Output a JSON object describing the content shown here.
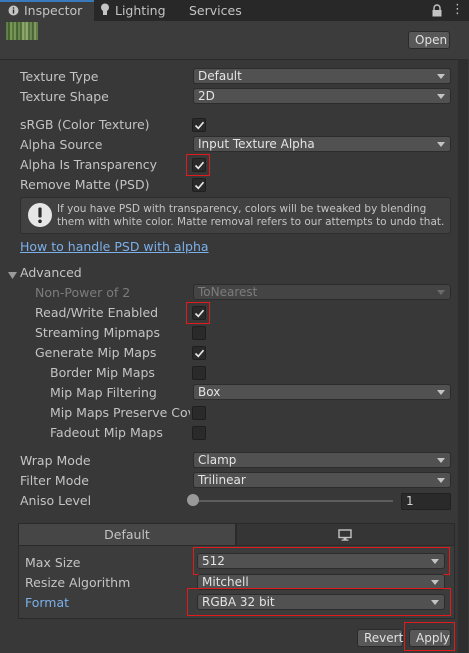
{
  "tabs": [
    {
      "label": "Inspector",
      "active": true,
      "icon": "inspector-info-icon"
    },
    {
      "label": "Lighting",
      "active": false,
      "icon": "lightbulb-icon"
    },
    {
      "label": "Services",
      "active": false
    }
  ],
  "header": {
    "open_label": "Open"
  },
  "fields": {
    "texture_type": {
      "label": "Texture Type",
      "value": "Default"
    },
    "texture_shape": {
      "label": "Texture Shape",
      "value": "2D"
    },
    "srgb": {
      "label": "sRGB (Color Texture)",
      "checked": true
    },
    "alpha_source": {
      "label": "Alpha Source",
      "value": "Input Texture Alpha"
    },
    "alpha_transparency": {
      "label": "Alpha Is Transparency",
      "checked": true
    },
    "remove_matte": {
      "label": "Remove Matte (PSD)",
      "checked": true
    },
    "help_text": "If you have PSD with transparency, colors will be tweaked by blending them with white color. Matte removal refers to our attempts to undo that.",
    "help_link": "How to handle PSD with alpha"
  },
  "advanced": {
    "label": "Advanced",
    "non_power_of_2": {
      "label": "Non-Power of 2",
      "value": "ToNearest"
    },
    "read_write": {
      "label": "Read/Write Enabled",
      "checked": true
    },
    "streaming_mipmaps": {
      "label": "Streaming Mipmaps",
      "checked": false
    },
    "generate_mip_maps": {
      "label": "Generate Mip Maps",
      "checked": true
    },
    "border_mip_maps": {
      "label": "Border Mip Maps",
      "checked": false
    },
    "mip_map_filtering": {
      "label": "Mip Map Filtering",
      "value": "Box"
    },
    "mip_maps_preserve": {
      "label": "Mip Maps Preserve Cove",
      "checked": false
    },
    "fadeout_mip_maps": {
      "label": "Fadeout Mip Maps",
      "checked": false
    }
  },
  "wrap": {
    "wrap_mode": {
      "label": "Wrap Mode",
      "value": "Clamp"
    },
    "filter_mode": {
      "label": "Filter Mode",
      "value": "Trilinear"
    },
    "aniso_level": {
      "label": "Aniso Level",
      "value": "1",
      "slider_fraction": 0.0
    }
  },
  "platform": {
    "default_tab": "Default",
    "second_tab_icon": "monitor-icon",
    "max_size": {
      "label": "Max Size",
      "value": "512"
    },
    "resize_algorithm": {
      "label": "Resize Algorithm",
      "value": "Mitchell"
    },
    "format": {
      "label": "Format",
      "value": "RGBA 32 bit"
    }
  },
  "footer": {
    "revert_label": "Revert",
    "apply_label": "Apply"
  },
  "colors": {
    "background": "#383838",
    "accent": "#3a79bb",
    "highlight_red": "#e01b1b",
    "link": "#7bb0ea"
  }
}
